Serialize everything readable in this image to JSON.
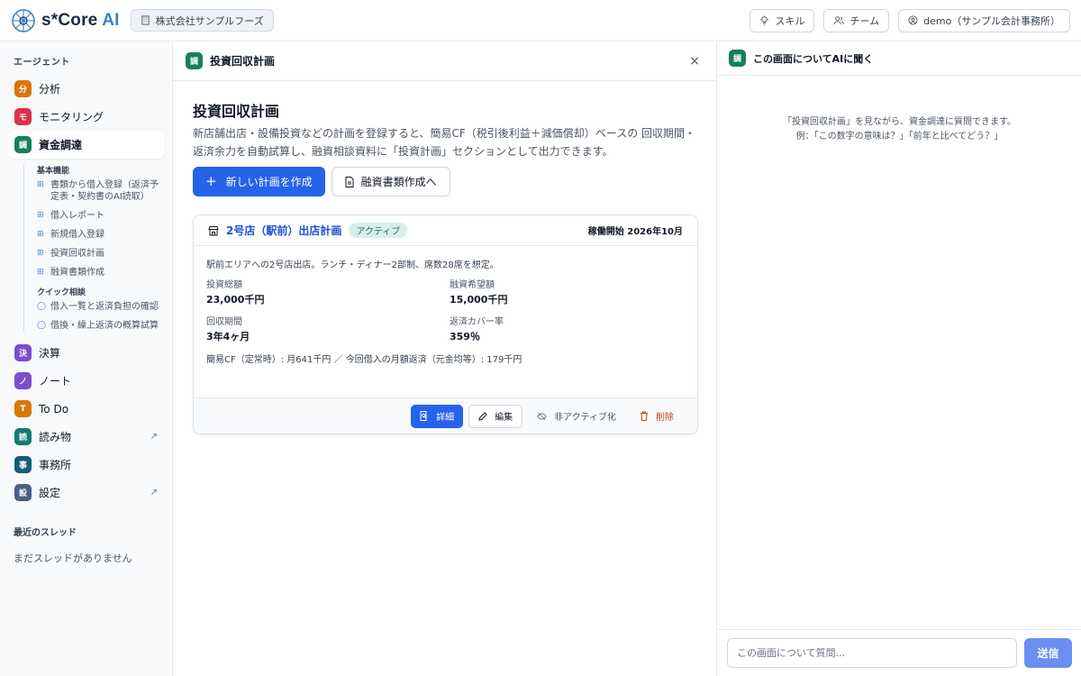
{
  "header": {
    "logo_prefix": "s*Core ",
    "logo_suffix": "AI",
    "company": "株式会社サンプルフーズ",
    "skills_label": "スキル",
    "team_label": "チーム",
    "user_label": "demo（サンプル会計事務所）"
  },
  "sidebar": {
    "section_title": "エージェント",
    "items": [
      {
        "badge": "分",
        "label": "分析",
        "color": "#d97706"
      },
      {
        "badge": "モ",
        "label": "モニタリング",
        "color": "#dc2f4a"
      },
      {
        "badge": "調",
        "label": "資金調達",
        "color": "#17805e"
      }
    ],
    "sub_basic_title": "基本機能",
    "sub_basic": [
      "書類から借入登録（返済予定表・契約書のAI読取）",
      "借入レポート",
      "新規借入登録",
      "投資回収計画",
      "融資書類作成"
    ],
    "sub_quick_title": "クイック相談",
    "sub_quick": [
      "借入一覧と返済負担の確認",
      "借換・繰上返済の概算試算"
    ],
    "items_after": [
      {
        "badge": "決",
        "label": "決算",
        "color": "#7c4dcc"
      },
      {
        "badge": "ノ",
        "label": "ノート",
        "color": "#7c4dcc"
      },
      {
        "badge": "T",
        "label": "To Do",
        "color": "#d97706"
      },
      {
        "badge": "読",
        "label": "読み物",
        "color": "#147a74"
      },
      {
        "badge": "事",
        "label": "事務所",
        "color": "#155e75"
      },
      {
        "badge": "設",
        "label": "設定",
        "color": "#4b5f86"
      }
    ],
    "external_mark": "↗",
    "recent_title": "最近のスレッド",
    "recent_empty": "まだスレッドがありません"
  },
  "main": {
    "header_badge": "調",
    "header_title": "投資回収計画",
    "close_label": "×",
    "page_title": "投資回収計画",
    "page_desc": "新店舗出店・設備投資などの計画を登録すると、簡易CF（税引後利益＋減価償却）ベースの 回収期間・返済余力を自動試算し、融資相談資料に「投資計画」セクションとして出力できます。",
    "new_plan_label": "新しい計画を作成",
    "loan_docs_label": "融資書類作成へ",
    "plan": {
      "name": "2号店（駅前）出店計画",
      "status": "アクティブ",
      "start": "稼働開始 2026年10月",
      "desc": "駅前エリアへの2号店出店。ランチ・ディナー2部制、席数28席を想定。",
      "investment_label": "投資総額",
      "investment_value": "23,000千円",
      "loan_label": "融資希望額",
      "loan_value": "15,000千円",
      "payback_label": "回収期間",
      "payback_value": "3年4ヶ月",
      "coverage_label": "返済カバー率",
      "coverage_value": "359％",
      "cf_summary": "簡易CF（定常時）: 月641千円 ／ 今回借入の月額返済（元金均等）: 179千円",
      "detail_label": "詳細",
      "edit_label": "編集",
      "deactivate_label": "非アクティブ化",
      "delete_label": "削除"
    }
  },
  "aside": {
    "header_badge": "調",
    "title": "この画面についてAIに聞く",
    "intro_line1": "「投資回収計画」を見ながら、資金調達に質問できます。",
    "intro_line2": "例：「この数字の意味は？」「前年と比べてどう？」",
    "input_placeholder": "この画面について質問...",
    "send_label": "送信"
  }
}
